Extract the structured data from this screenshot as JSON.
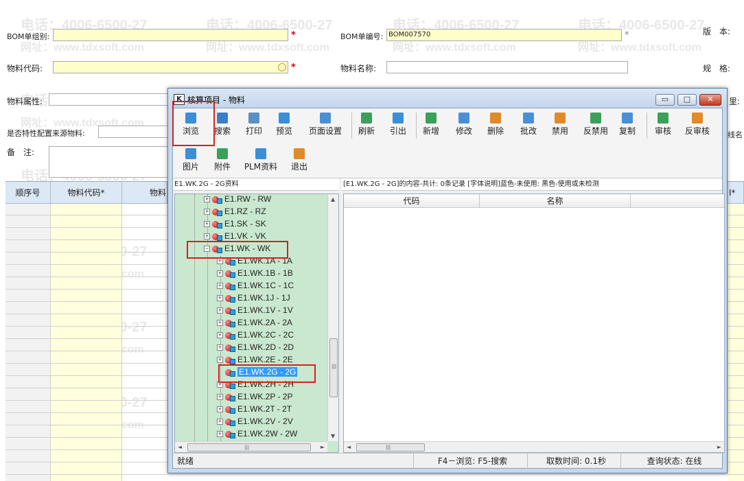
{
  "watermark": {
    "phone": "电话：4006-6500-27",
    "site": "网址：www.tdxsoft.com"
  },
  "form": {
    "bom_group_label": "BOM单组别:",
    "bom_no_label": "BOM单编号:",
    "bom_no_value": "BOM007570",
    "version_label": "版　本:",
    "material_code_label": "物料代码:",
    "material_name_label": "物料名称:",
    "spec_label": "规　格:",
    "material_attr_label": "物料属性:",
    "config_source_label": "是否特性配置来源物料:",
    "remark_label": "备　注:",
    "required_mark": "*",
    "partial_right_1": "里:",
    "partial_right_2": "线名"
  },
  "bg_grid": {
    "headers": [
      "顺序号",
      "物料代码*",
      "物料"
    ],
    "right_header": "I*"
  },
  "dialog": {
    "title": "核算项目 - 物料",
    "app_icon_glyph": "K",
    "min_glyph": "▭",
    "max_glyph": "□",
    "close_glyph": "✕",
    "toolbar_row1": [
      {
        "label": "浏览",
        "color": "#3a8fd6"
      },
      {
        "label": "搜索",
        "color": "#3a7fc6"
      },
      {
        "label": "打印",
        "color": "#5a8fc6"
      },
      {
        "label": "预览",
        "color": "#3a8fd6"
      },
      {
        "label": "页面设置",
        "color": "#4a8fd6"
      },
      {
        "label": "刷新",
        "color": "#3aa05a"
      },
      {
        "label": "引出",
        "color": "#3a8fd6"
      },
      {
        "label": "新增",
        "color": "#3aa05a"
      },
      {
        "label": "修改",
        "color": "#4a8fd6"
      },
      {
        "label": "删除",
        "color": "#e08a2a"
      },
      {
        "label": "批改",
        "color": "#4a8fd6"
      },
      {
        "label": "禁用",
        "color": "#e08a2a"
      },
      {
        "label": "反禁用",
        "color": "#3aa05a"
      },
      {
        "label": "复制",
        "color": "#4a8fd6"
      },
      {
        "label": "审核",
        "color": "#3aa05a"
      },
      {
        "label": "反审核",
        "color": "#e08a2a"
      }
    ],
    "toolbar_row2": [
      {
        "label": "图片",
        "color": "#3a8fd6"
      },
      {
        "label": "附件",
        "color": "#3aa05a"
      },
      {
        "label": "PLM资料",
        "color": "#3a8fd6"
      },
      {
        "label": "退出",
        "color": "#e08a2a"
      }
    ],
    "path_label": "E1.WK.2G - 2G资料",
    "info_text": "[E1.WK.2G - 2G]的内容-共计: 0条记录  [字体说明]蓝色-未使用: 黑色-使用或未检测",
    "tree_items": [
      {
        "label": "E1.RW - RW",
        "level": 0,
        "exp": "+"
      },
      {
        "label": "E1.RZ - RZ",
        "level": 0,
        "exp": "+"
      },
      {
        "label": "E1.SK - SK",
        "level": 0,
        "exp": "+"
      },
      {
        "label": "E1.VK - VK",
        "level": 0,
        "exp": "+"
      },
      {
        "label": "E1.WK - WK",
        "level": 0,
        "exp": "−"
      },
      {
        "label": "E1.WK.1A - 1A",
        "level": 1,
        "exp": "+"
      },
      {
        "label": "E1.WK.1B - 1B",
        "level": 1,
        "exp": "+"
      },
      {
        "label": "E1.WK.1C - 1C",
        "level": 1,
        "exp": "+"
      },
      {
        "label": "E1.WK.1J - 1J",
        "level": 1,
        "exp": "+"
      },
      {
        "label": "E1.WK.1V - 1V",
        "level": 1,
        "exp": "+"
      },
      {
        "label": "E1.WK.2A - 2A",
        "level": 1,
        "exp": "+"
      },
      {
        "label": "E1.WK.2C - 2C",
        "level": 1,
        "exp": "+"
      },
      {
        "label": "E1.WK.2D - 2D",
        "level": 1,
        "exp": "+"
      },
      {
        "label": "E1.WK.2E - 2E",
        "level": 1,
        "exp": "+"
      },
      {
        "label": "E1.WK.2G - 2G",
        "level": 1,
        "exp": "",
        "selected": true
      },
      {
        "label": "E1.WK.2H - 2H",
        "level": 1,
        "exp": "+"
      },
      {
        "label": "E1.WK.2P - 2P",
        "level": 1,
        "exp": "+"
      },
      {
        "label": "E1.WK.2T - 2T",
        "level": 1,
        "exp": "+"
      },
      {
        "label": "E1.WK.2V - 2V",
        "level": 1,
        "exp": "+"
      },
      {
        "label": "E1.WK.2W - 2W",
        "level": 1,
        "exp": "+"
      }
    ],
    "grid_headers": [
      "代码",
      "名称",
      ""
    ],
    "status": {
      "ready": "就绪",
      "keys": "F4－浏览: F5-搜索",
      "time": "取数时间: 0.1秒",
      "query": "查询状态: 在线"
    },
    "scroll": {
      "up": "▲",
      "down": "▼",
      "left": "◄",
      "right": "►",
      "grip": "|||"
    }
  }
}
